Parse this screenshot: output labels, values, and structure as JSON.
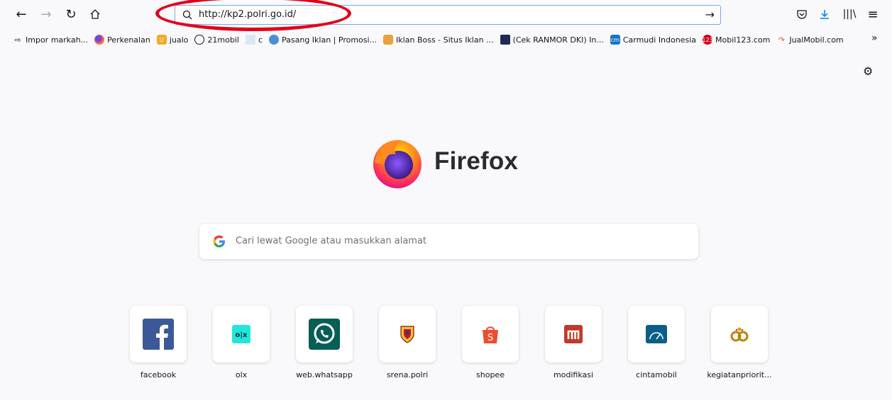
{
  "urlbar": {
    "value": "http://kp2.polri.go.id/"
  },
  "bookmarks": [
    {
      "label": "Impor markah...",
      "icon": "import-icon"
    },
    {
      "label": "Perkenalan",
      "icon": "firefox-icon"
    },
    {
      "label": "jualo",
      "icon": "jualo-icon"
    },
    {
      "label": "21mobil",
      "icon": "globe-icon"
    },
    {
      "label": "c",
      "icon": "page-icon"
    },
    {
      "label": "Pasang Iklan | Promosi...",
      "icon": "globe-color-icon"
    },
    {
      "label": "Iklan Boss - Situs Iklan ...",
      "icon": "iklanboss-icon"
    },
    {
      "label": "(Cek RANMOR DKI) In...",
      "icon": "police-icon"
    },
    {
      "label": "Carmudi Indonesia",
      "icon": "carmudi-icon"
    },
    {
      "label": "Mobil123.com",
      "icon": "mobil123-icon"
    },
    {
      "label": "JualMobil.com",
      "icon": "jualmobil-icon"
    }
  ],
  "brand": {
    "name": "Firefox"
  },
  "search": {
    "placeholder": "Cari lewat Google atau masukkan alamat"
  },
  "topsites": [
    {
      "label": "facebook",
      "icon": "facebook-icon",
      "color": "#3b5998"
    },
    {
      "label": "olx",
      "icon": "olx-icon",
      "color": "#23e5db"
    },
    {
      "label": "web.whatsapp",
      "icon": "whatsapp-icon",
      "color": "#075e54"
    },
    {
      "label": "srena.polri",
      "icon": "polri-emblem-icon",
      "color": "#c8102e"
    },
    {
      "label": "shopee",
      "icon": "shopee-icon",
      "color": "#ee4d2d"
    },
    {
      "label": "modifikasi",
      "icon": "modifikasi-icon",
      "color": "#c0392b"
    },
    {
      "label": "cintamobil",
      "icon": "cintamobil-icon",
      "color": "#0b5e8a"
    },
    {
      "label": "kegiatanpriorit...",
      "icon": "kegiatan-emblem-icon",
      "color": "#b8860b"
    }
  ]
}
